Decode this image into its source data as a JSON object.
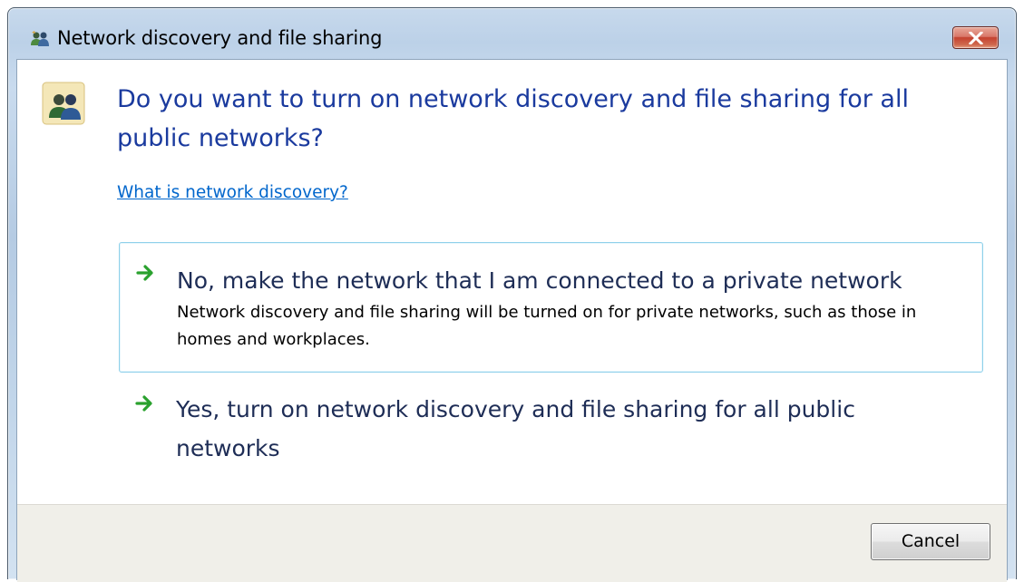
{
  "window": {
    "title": "Network discovery and file sharing",
    "title_icon": "people-icon",
    "close_icon": "close-icon"
  },
  "dialog": {
    "main_icon": "people-icon",
    "main_instruction": "Do you want to turn on network discovery and file sharing for all public networks?",
    "help_link": "What is network discovery?",
    "commands": [
      {
        "icon": "green-arrow-icon",
        "title": "No, make the network that I am connected to a private network",
        "description": "Network discovery and file sharing will be turned on for private networks, such as those in homes and workplaces."
      },
      {
        "icon": "green-arrow-icon",
        "title": "Yes, turn on network discovery and file sharing for all public networks",
        "description": ""
      }
    ]
  },
  "footer": {
    "cancel_label": "Cancel"
  },
  "colors": {
    "instruction_text": "#1a3a9e",
    "link": "#0066cc",
    "command_highlight_border": "#8fd0ea",
    "close_button": "#c4412f",
    "footer_background": "#f0efe9"
  }
}
